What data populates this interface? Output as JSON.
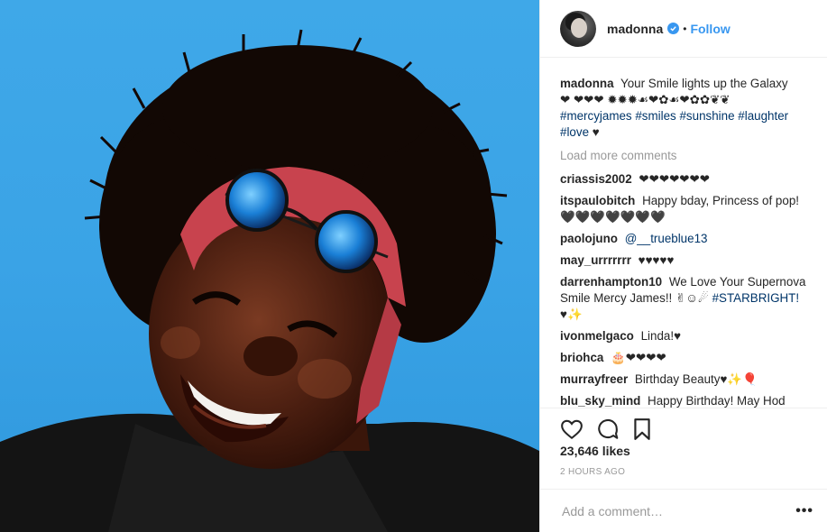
{
  "post": {
    "username": "madonna",
    "follow_label": "Follow",
    "separator": "•",
    "caption": {
      "username": "madonna",
      "text": "Your Smile lights up the Galaxy",
      "line2": "❤ ❤❤❤ ✹✹✹☙❤✿☙❤✿✿❦❦",
      "hashtags": [
        "#mercyjames",
        "#smiles",
        "#sunshine",
        "#laughter",
        "#love"
      ],
      "trailing": "♥"
    },
    "load_more": "Load more comments",
    "comments": [
      {
        "user": "criassis2002",
        "text": "❤❤❤❤❤❤❤"
      },
      {
        "user": "itspaulobitch",
        "text": "Happy bday, Princess of pop! 🖤🖤🖤🖤🖤🖤🖤"
      },
      {
        "user": "paolojuno",
        "mention": "@__trueblue13",
        "text": ""
      },
      {
        "user": "may_urrrrrrr",
        "text": "♥♥♥♥♥"
      },
      {
        "user": "darrenhampton10",
        "text": "We Love Your Supernova Smile Mercy James!! ✌☺☄",
        "hashtag": "#STARBRIGHT!",
        "tail": "♥✨"
      },
      {
        "user": "ivonmelgaco",
        "text": "Linda!♥"
      },
      {
        "user": "briohca",
        "text": "🎂❤❤❤❤"
      },
      {
        "user": "murrayfreer",
        "text": "Birthday Beauty♥✨🎈"
      },
      {
        "user": "blu_sky_mind",
        "text": "Happy Birthday! May Hod"
      }
    ],
    "likes": "23,646 likes",
    "time": "2 HOURS AGO",
    "add_comment_placeholder": "Add a comment…",
    "more_label": "•••",
    "icons": {
      "like": "heart-icon",
      "comment": "comment-icon",
      "save": "bookmark-icon",
      "verified": "verified-badge-icon"
    },
    "colors": {
      "accent": "#3897f0",
      "hashtag": "#003569",
      "muted": "#999999",
      "sky": "#3aa3e6"
    }
  }
}
